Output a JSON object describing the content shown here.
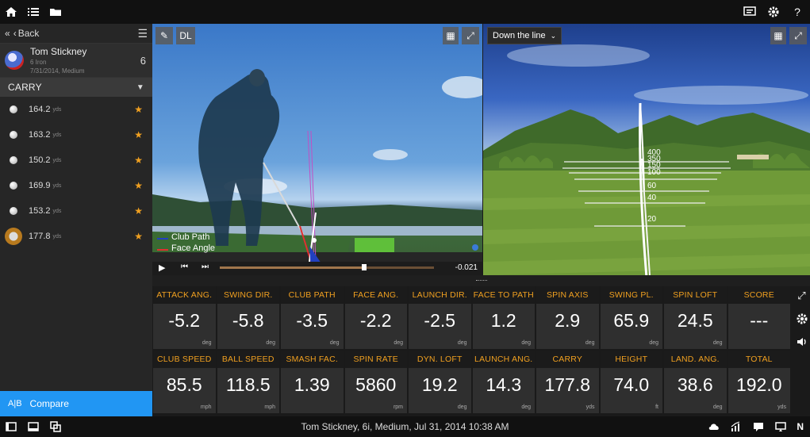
{
  "sidebar": {
    "back_label": "Back",
    "player": {
      "name": "Tom Stickney",
      "club": "6 Iron",
      "details": "7/31/2014, Medium",
      "count": "6"
    },
    "section_title": "CARRY",
    "shots": [
      {
        "value": "164.2",
        "unit": "yds"
      },
      {
        "value": "163.2",
        "unit": "yds"
      },
      {
        "value": "150.2",
        "unit": "yds"
      },
      {
        "value": "169.9",
        "unit": "yds"
      },
      {
        "value": "153.2",
        "unit": "yds"
      },
      {
        "value": "177.8",
        "unit": "yds",
        "selected": true
      }
    ],
    "compare_icon": "A|B",
    "compare_label": "Compare"
  },
  "video": {
    "dl_label": "DL",
    "legend_club_path": "Club Path",
    "legend_face_angle": "Face Angle",
    "time_readout": "-0.021"
  },
  "sim": {
    "view_select": "Down the line",
    "distance_labels": [
      "400",
      "150",
      "100",
      "60",
      "40",
      "20"
    ],
    "distance_label_extra": "350"
  },
  "metrics": {
    "row1": [
      {
        "label": "ATTACK ANG.",
        "value": "-5.2",
        "unit": "deg"
      },
      {
        "label": "SWING DIR.",
        "value": "-5.8",
        "unit": "deg"
      },
      {
        "label": "CLUB PATH",
        "value": "-3.5",
        "unit": "deg"
      },
      {
        "label": "FACE ANG.",
        "value": "-2.2",
        "unit": "deg"
      },
      {
        "label": "LAUNCH DIR.",
        "value": "-2.5",
        "unit": "deg"
      },
      {
        "label": "FACE TO PATH",
        "value": "1.2",
        "unit": "deg"
      },
      {
        "label": "SPIN AXIS",
        "value": "2.9",
        "unit": "deg"
      },
      {
        "label": "SWING PL.",
        "value": "65.9",
        "unit": "deg"
      },
      {
        "label": "SPIN LOFT",
        "value": "24.5",
        "unit": "deg"
      },
      {
        "label": "SCORE",
        "value": "---",
        "unit": ""
      }
    ],
    "row2": [
      {
        "label": "CLUB SPEED",
        "value": "85.5",
        "unit": "mph"
      },
      {
        "label": "BALL SPEED",
        "value": "118.5",
        "unit": "mph"
      },
      {
        "label": "SMASH FAC.",
        "value": "1.39",
        "unit": ""
      },
      {
        "label": "SPIN RATE",
        "value": "5860",
        "unit": "rpm"
      },
      {
        "label": "DYN. LOFT",
        "value": "19.2",
        "unit": "deg"
      },
      {
        "label": "LAUNCH ANG.",
        "value": "14.3",
        "unit": "deg"
      },
      {
        "label": "CARRY",
        "value": "177.8",
        "unit": "yds"
      },
      {
        "label": "HEIGHT",
        "value": "74.0",
        "unit": "ft"
      },
      {
        "label": "LAND. ANG.",
        "value": "38.6",
        "unit": "deg"
      },
      {
        "label": "TOTAL",
        "value": "192.0",
        "unit": "yds"
      }
    ]
  },
  "status": {
    "text": "Tom Stickney, 6i, Medium, Jul 31, 2014 10:38 AM",
    "n_label": "N"
  },
  "colors": {
    "accent": "#2196f3",
    "label_orange": "#f0a020",
    "star": "#f0a020"
  }
}
